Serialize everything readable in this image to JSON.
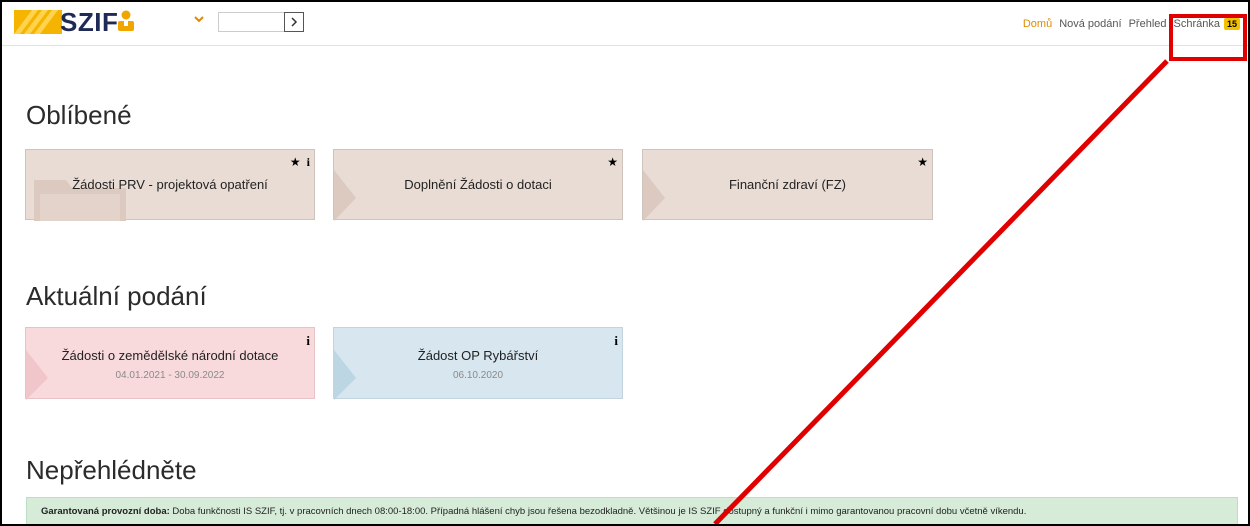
{
  "header": {
    "logo_text": "SZIF",
    "id_input_value": "",
    "nav": [
      {
        "label": "Domů",
        "active": true
      },
      {
        "label": "Nová podání",
        "active": false
      },
      {
        "label": "Přehled",
        "active": false
      },
      {
        "label": "Schránka",
        "active": false
      }
    ],
    "inbox_count": "15"
  },
  "favorites": {
    "heading": "Oblíbené",
    "tiles": [
      {
        "title": "Žádosti PRV - projektová opatření",
        "icons": [
          "star-icon",
          "info-icon"
        ]
      },
      {
        "title": "Doplnění Žádosti o dotaci",
        "icons": [
          "star-icon"
        ]
      },
      {
        "title": "Finanční zdraví (FZ)",
        "icons": [
          "star-icon"
        ]
      }
    ]
  },
  "current": {
    "heading": "Aktuální podání",
    "tiles": [
      {
        "title": "Žádosti o zemědělské národní dotace",
        "dates": "04.01.2021 - 30.09.2022",
        "color": "#f8d9dc"
      },
      {
        "title": "Žádost OP Rybářství",
        "dates": "06.10.2020",
        "color": "#d7e6ef"
      }
    ]
  },
  "notice": {
    "heading": "Nepřehlédněte",
    "label": "Garantovaná provozní doba:",
    "text": " Doba funkčnosti IS SZIF, tj. v pracovních dnech 08:00-18:00. Případná hlášení chyb jsou řešena bezodkladně. Většinou je IS SZIF dostupný a funkční i mimo garantovanou pracovní dobu včetně víkendu."
  },
  "colors": {
    "accent": "#e08a00",
    "highlight": "#e00000",
    "brand": "#1f2a55"
  }
}
